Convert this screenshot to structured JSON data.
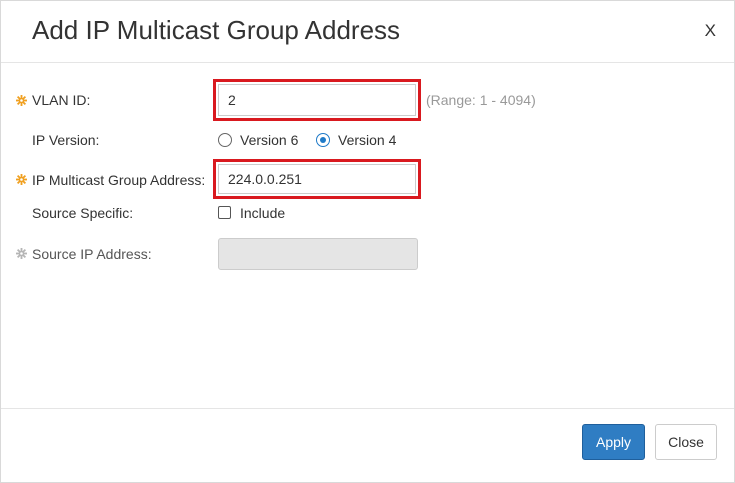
{
  "dialog": {
    "title": "Add IP Multicast Group Address",
    "close_label": "X"
  },
  "form": {
    "vlan_id": {
      "label": "VLAN ID:",
      "value": "2",
      "hint": "(Range: 1 - 4094)"
    },
    "ip_version": {
      "label": "IP Version:",
      "options": [
        "Version 6",
        "Version 4"
      ],
      "selected": "Version 4"
    },
    "group_address": {
      "label": "IP Multicast Group Address:",
      "value": "224.0.0.251"
    },
    "source_specific": {
      "label": "Source Specific:",
      "checkbox_label": "Include",
      "checked": false
    },
    "source_ip": {
      "label": "Source IP Address:",
      "value": ""
    }
  },
  "footer": {
    "apply_label": "Apply",
    "close_label": "Close"
  },
  "colors": {
    "required_icon": "#f0a020",
    "disabled_icon": "#b5b5b5",
    "highlight": "#d9191f",
    "primary": "#2f7dc3"
  }
}
